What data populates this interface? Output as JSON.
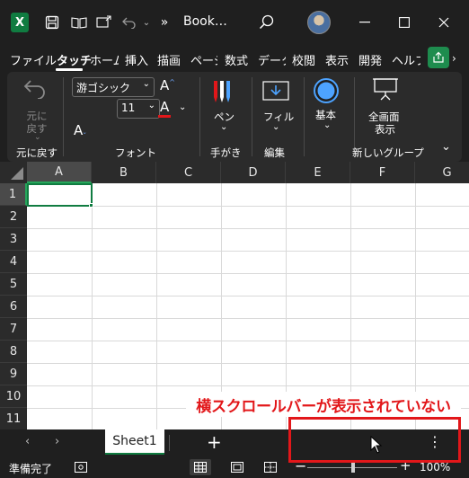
{
  "titlebar": {
    "doc_title": "Book…",
    "app_icon": "excel-icon"
  },
  "tabs": [
    "ファイル",
    "タッチ",
    "ホーム",
    "挿入",
    "描画",
    "ページ",
    "数式",
    "データ",
    "校閲",
    "表示",
    "開発",
    "ヘルプ"
  ],
  "active_tab": "タッチ",
  "ribbon": {
    "undo_label": "元に戻す",
    "undo_group": "元に戻す",
    "font_name": "游ゴシック",
    "font_size": "11",
    "font_group": "フォント",
    "pen_label": "ペン",
    "handwriting_group": "手がき",
    "fill_label": "フィル",
    "edit_group": "編集",
    "basic_label": "基本",
    "fullscreen_label_1": "全画面",
    "fullscreen_label_2": "表示",
    "new_group": "新しいグループ"
  },
  "grid": {
    "columns": [
      "A",
      "B",
      "C",
      "D",
      "E",
      "F",
      "G"
    ],
    "rows": [
      "1",
      "2",
      "3",
      "4",
      "5",
      "6",
      "7",
      "8",
      "9",
      "10",
      "11"
    ],
    "selected_cell": "A1"
  },
  "sheetbar": {
    "sheet_name": "Sheet1",
    "add_label": "+",
    "more_label": "⋮"
  },
  "statusbar": {
    "status": "準備完了",
    "zoom": "100%"
  },
  "annotation": {
    "text": "横スクロールバーが表示されていない"
  },
  "colors": {
    "accent_green": "#107c41",
    "annotation_red": "#e2171a"
  }
}
